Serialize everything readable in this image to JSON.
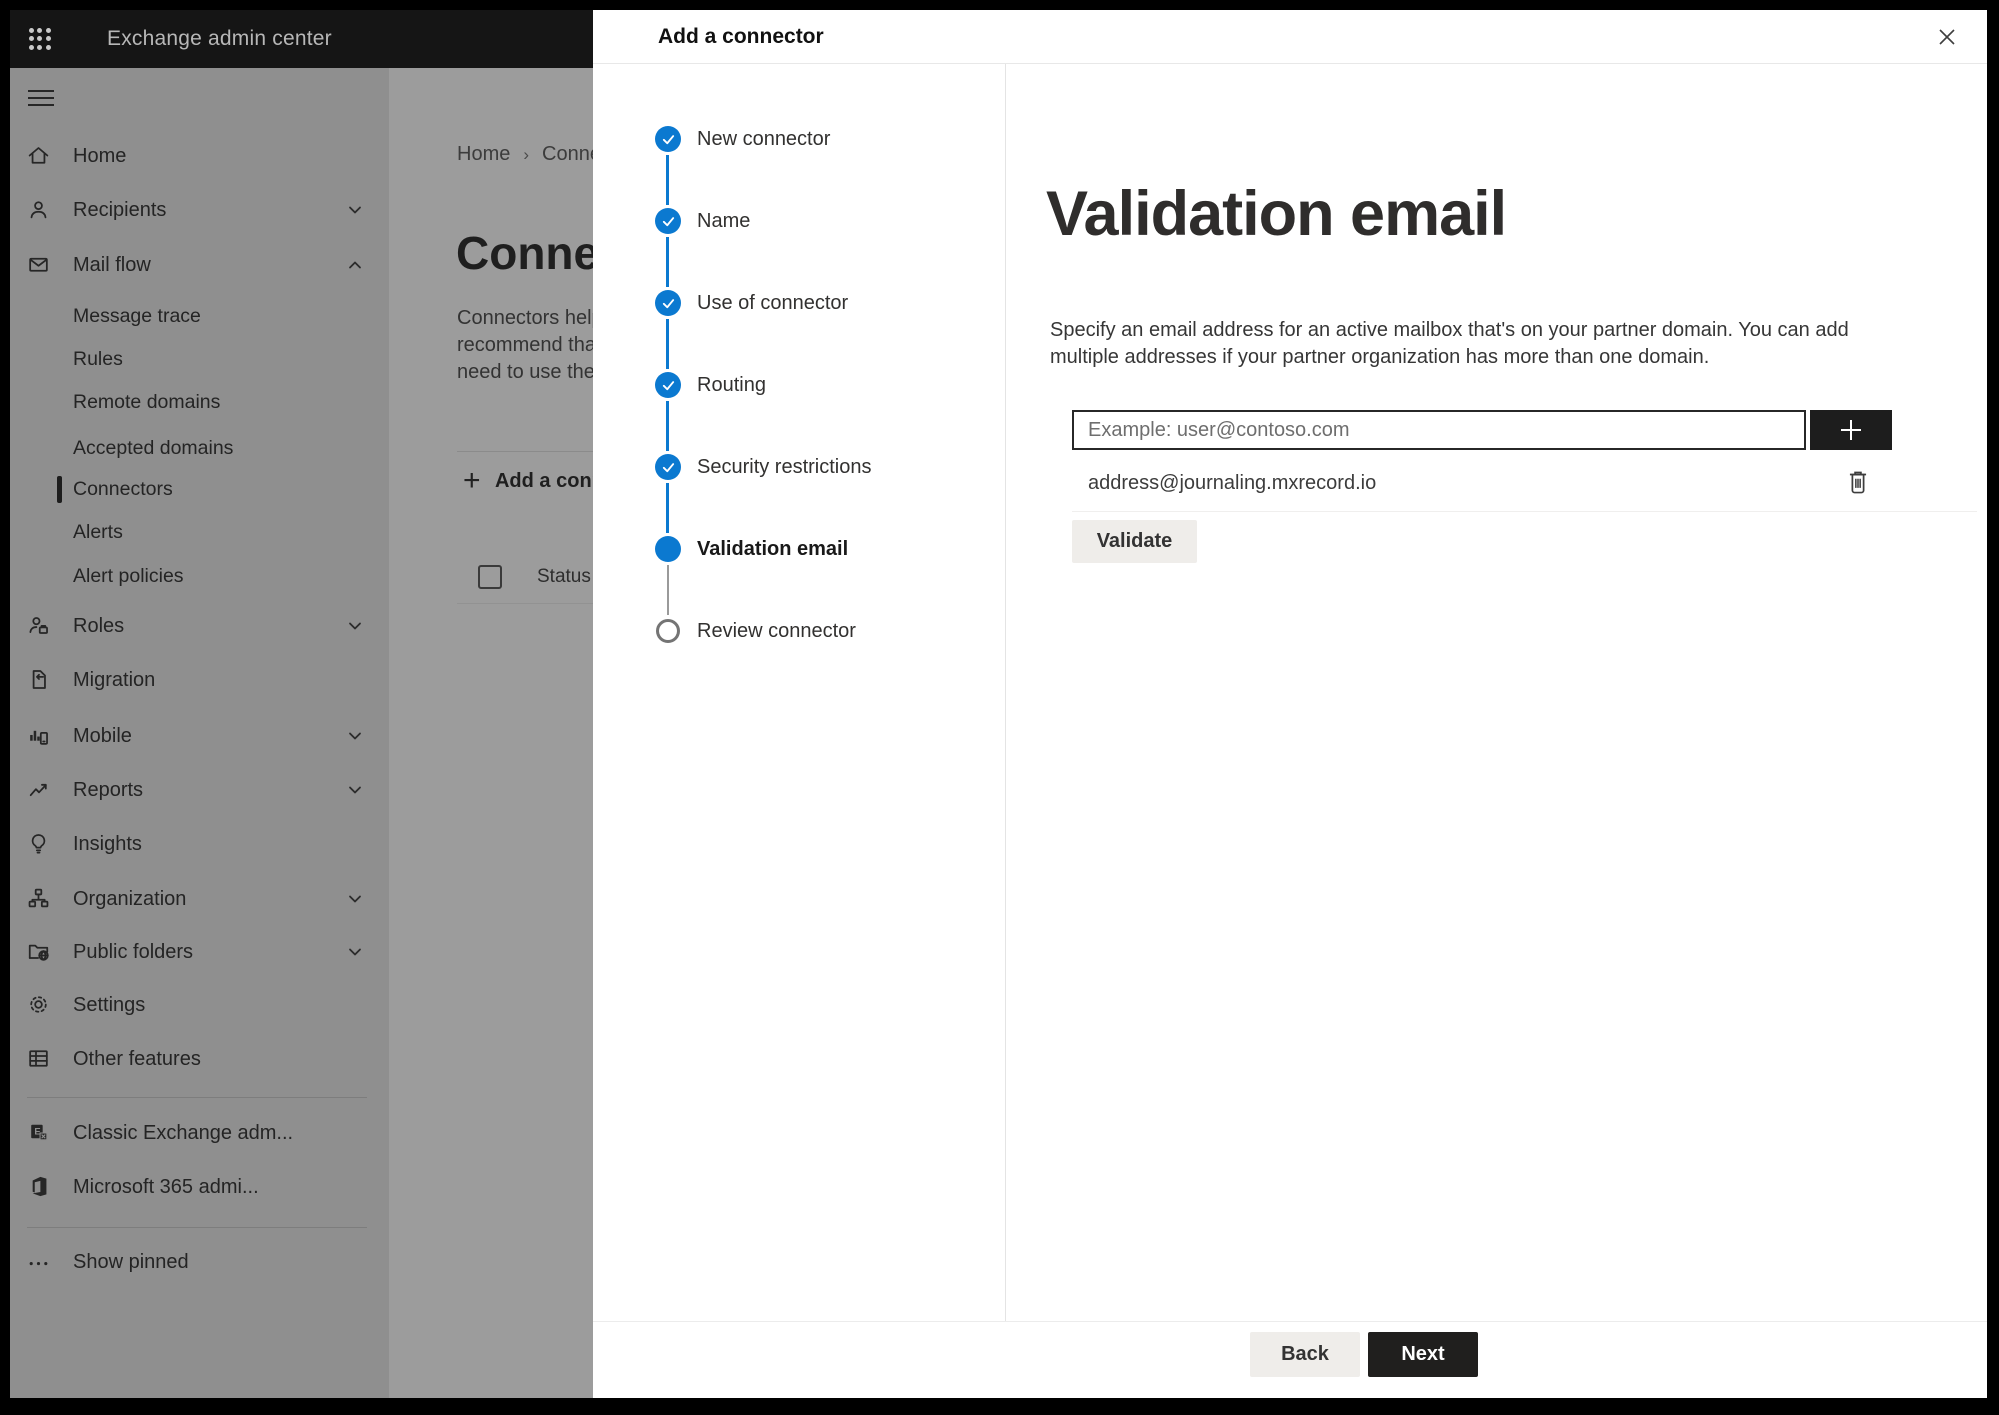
{
  "topbar": {
    "title": "Exchange admin center"
  },
  "sidebar": {
    "items": [
      {
        "label": "Home",
        "icon": "home"
      },
      {
        "label": "Recipients",
        "icon": "person",
        "chevron": "down"
      },
      {
        "label": "Mail flow",
        "icon": "mail",
        "chevron": "up"
      },
      {
        "label": "Message trace",
        "sub": true
      },
      {
        "label": "Rules",
        "sub": true
      },
      {
        "label": "Remote domains",
        "sub": true
      },
      {
        "label": "Accepted domains",
        "sub": true
      },
      {
        "label": "Connectors",
        "sub": true,
        "selected": true
      },
      {
        "label": "Alerts",
        "sub": true
      },
      {
        "label": "Alert policies",
        "sub": true
      },
      {
        "label": "Roles",
        "icon": "roles",
        "chevron": "down"
      },
      {
        "label": "Migration",
        "icon": "migration"
      },
      {
        "label": "Mobile",
        "icon": "mobile",
        "chevron": "down"
      },
      {
        "label": "Reports",
        "icon": "reports",
        "chevron": "down"
      },
      {
        "label": "Insights",
        "icon": "insights"
      },
      {
        "label": "Organization",
        "icon": "organization",
        "chevron": "down"
      },
      {
        "label": "Public folders",
        "icon": "public-folders",
        "chevron": "down"
      },
      {
        "label": "Settings",
        "icon": "settings"
      },
      {
        "label": "Other features",
        "icon": "other-features"
      },
      {
        "divider": true
      },
      {
        "label": "Classic Exchange adm...",
        "icon": "exchange-logo"
      },
      {
        "label": "Microsoft 365 admi...",
        "icon": "office-logo"
      },
      {
        "divider": true
      },
      {
        "label": "Show pinned",
        "icon": "ellipsis"
      }
    ]
  },
  "page": {
    "breadcrumb": {
      "home": "Home",
      "separator": "›",
      "current": "Conne"
    },
    "heading": "Connec",
    "paragraph_lines": [
      "Connectors help",
      "recommend that",
      "need to use ther"
    ],
    "add_button_label": "Add a conn",
    "table": {
      "status_header": "Status"
    }
  },
  "panel": {
    "title": "Add a connector",
    "steps": [
      {
        "label": "New connector",
        "state": "done"
      },
      {
        "label": "Name",
        "state": "done"
      },
      {
        "label": "Use of connector",
        "state": "done"
      },
      {
        "label": "Routing",
        "state": "done"
      },
      {
        "label": "Security restrictions",
        "state": "done"
      },
      {
        "label": "Validation email",
        "state": "current"
      },
      {
        "label": "Review connector",
        "state": "todo"
      }
    ],
    "content": {
      "heading": "Validation email",
      "description_lines": [
        "Specify an email address for an active mailbox that's on your partner domain. You can add",
        "multiple addresses if your partner organization has more than one domain."
      ],
      "email_placeholder": "Example: user@contoso.com",
      "address_value": "address@journaling.mxrecord.io",
      "validate_label": "Validate"
    },
    "footer": {
      "back_label": "Back",
      "next_label": "Next"
    }
  },
  "colors": {
    "accent": "#0b79d0",
    "topbar": "#151515",
    "next_button": "#201f1e"
  }
}
